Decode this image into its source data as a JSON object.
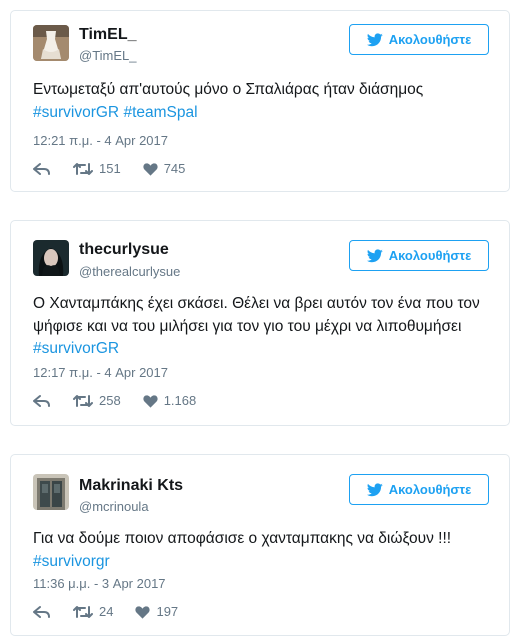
{
  "follow_label": "Ακολουθήστε",
  "colors": {
    "accent": "#1da1f2",
    "hashtag": "#1b95e0",
    "meta": "#657786",
    "border": "#e1e8ed"
  },
  "tweets": [
    {
      "display_name": "TimEL_",
      "handle": "@TimEL_",
      "text": "Εντωμεταξύ απ'αυτούς μόνο ο Σπαλιάρας ήταν διάσημος",
      "hashtags": [
        "#survivorGR",
        "#teamSpal"
      ],
      "timestamp": "12:21 π.μ. - 4 Apr 2017",
      "retweets": "151",
      "likes": "745",
      "avatar_icon": "dress-avatar-icon"
    },
    {
      "display_name": "thecurlysue",
      "handle": "@therealcurlysue",
      "text": "Ο Χανταμπάκης έχει σκάσει. Θέλει να βρει αυτόν τον ένα που τον ψήφισε και να του μιλήσει για τον γιο του μέχρι να λιποθυμήσει",
      "hashtags": [
        "#survivorGR"
      ],
      "timestamp": "12:17 π.μ. - 4 Apr 2017",
      "retweets": "258",
      "likes": "1.168",
      "avatar_icon": "portrait-avatar-icon"
    },
    {
      "display_name": "Makrinaki Kts",
      "handle": "@mcrinoula",
      "text": "Για να δούμε ποιον αποφάσισε ο χανταμπακης να διώξουν !!!",
      "hashtags": [
        "#survivorgr"
      ],
      "timestamp": "11:36 μ.μ. - 3 Apr 2017",
      "retweets": "24",
      "likes": "197",
      "avatar_icon": "door-avatar-icon"
    }
  ]
}
